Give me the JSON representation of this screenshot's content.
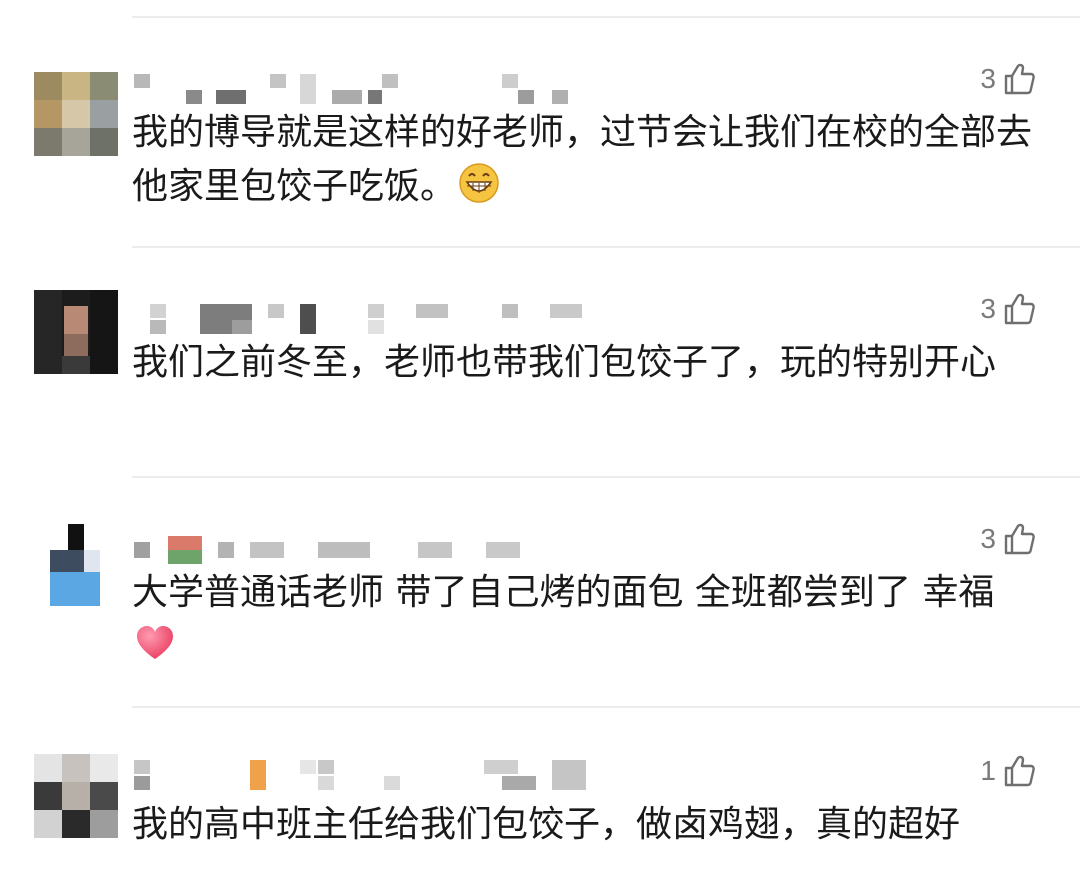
{
  "comments": [
    {
      "likes": "3",
      "text": "我的博导就是这样的好老师，过节会让我们在校的全部去他家里包饺子吃饭。",
      "emoji": "grinning-face-emoji"
    },
    {
      "likes": "3",
      "text": "我们之前冬至，老师也带我们包饺子了，玩的特别开心"
    },
    {
      "likes": "3",
      "text": "大学普通话老师 带了自己烤的面包 全班都尝到了 幸福",
      "emoji": "heart-emoji"
    },
    {
      "likes": "1",
      "text": "我的高中班主任给我们包饺子，做卤鸡翅，真的超好"
    }
  ],
  "icons": {
    "like": "thumbs-up-outline-icon"
  },
  "colors": {
    "text": "#1a1a1a",
    "like_count": "#7a7a7a",
    "divider": "#ececec",
    "heart": "#f0506e",
    "grin_face": "#f5c542"
  }
}
